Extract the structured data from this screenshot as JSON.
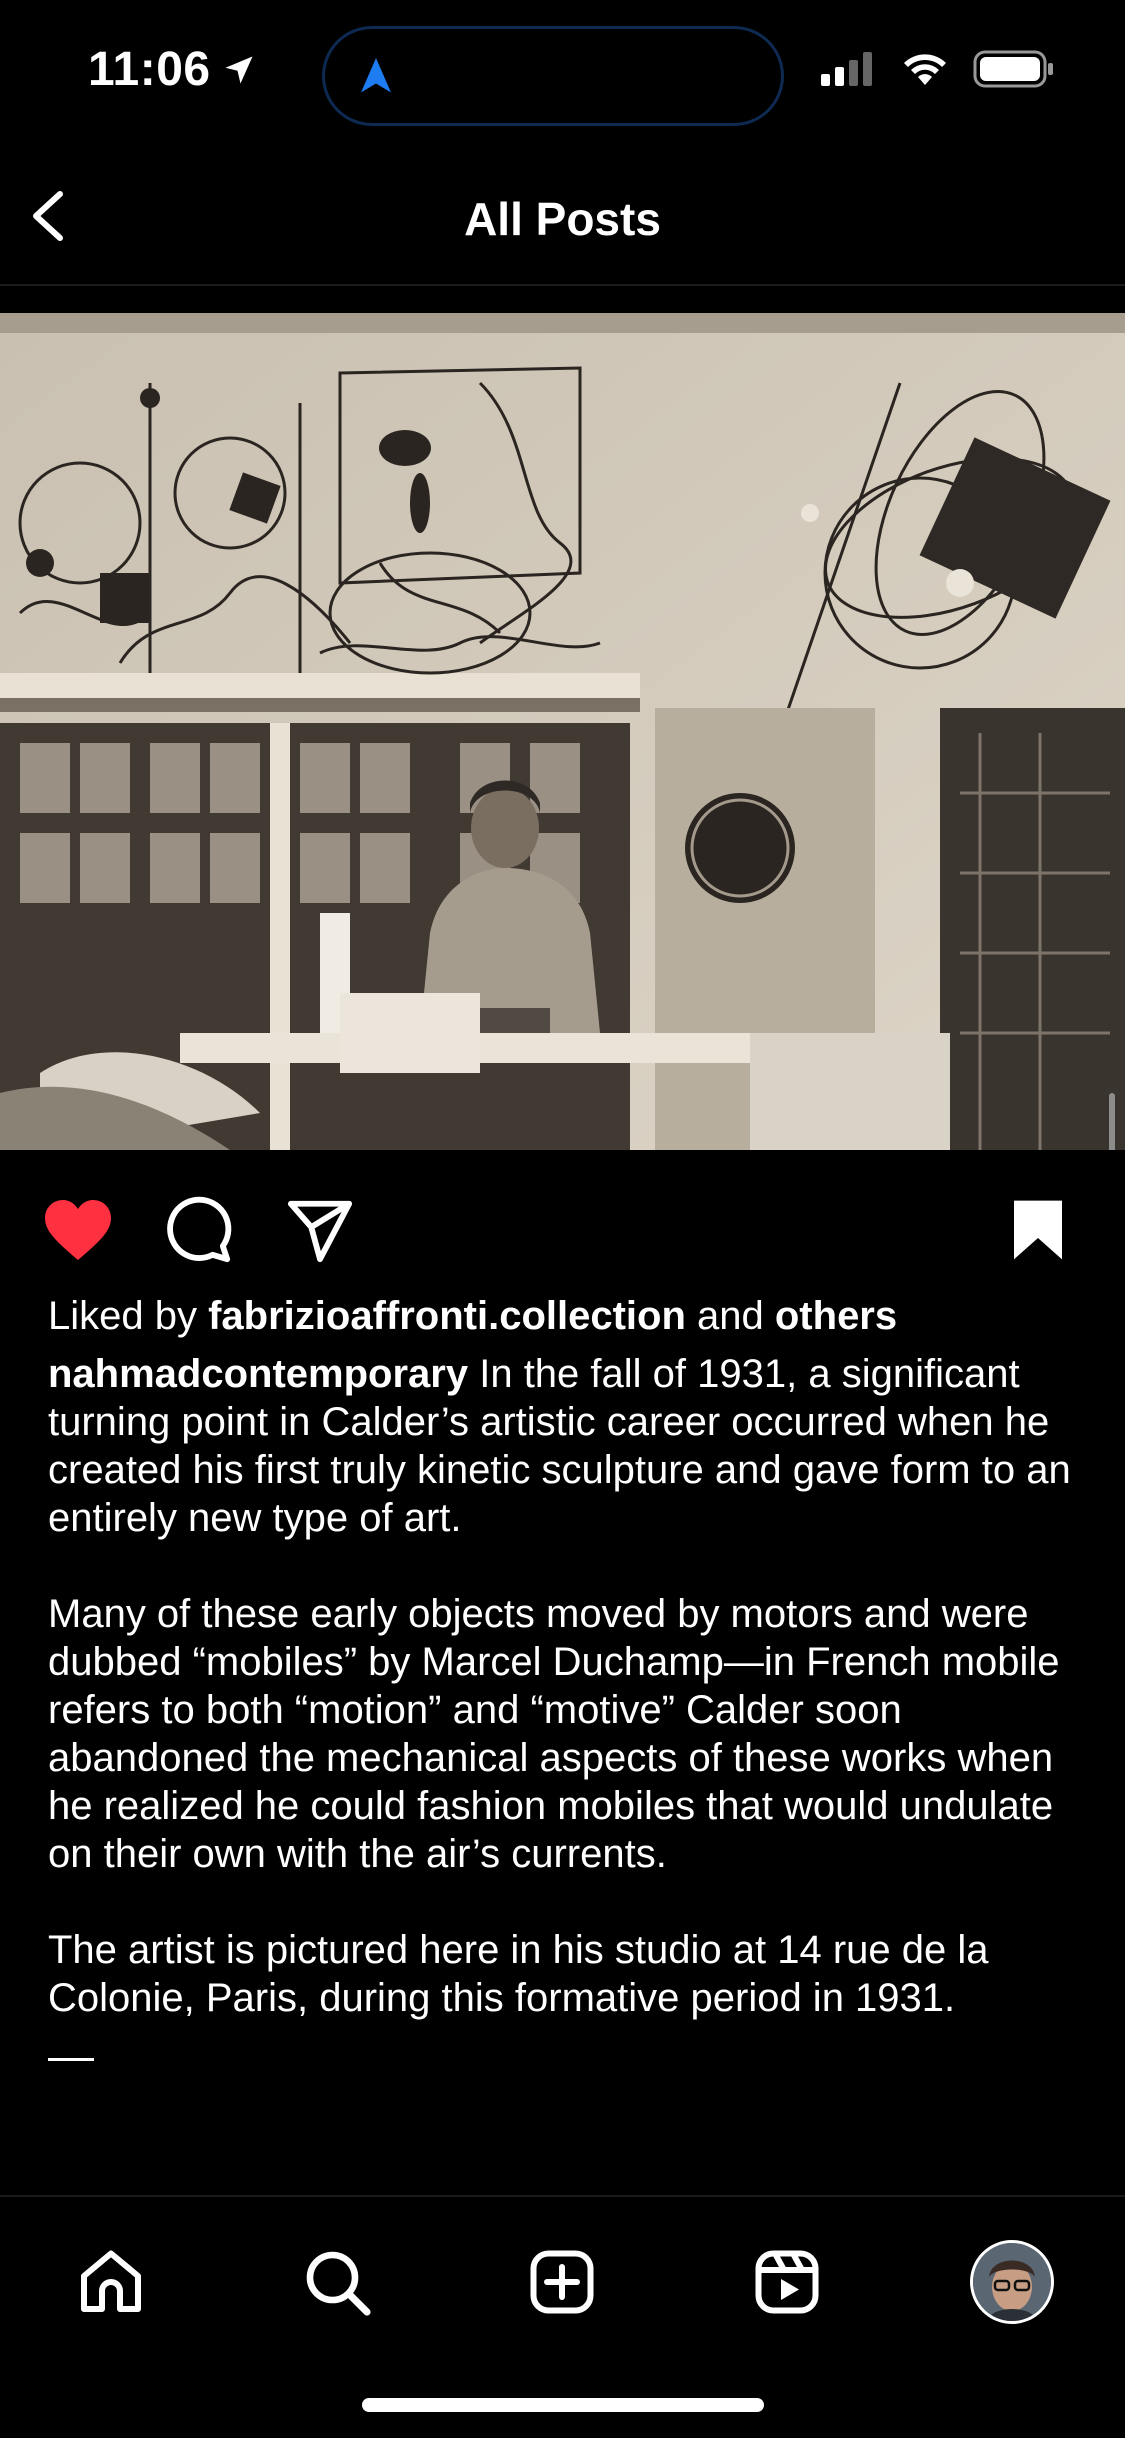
{
  "status": {
    "time": "11:06"
  },
  "header": {
    "title": "All Posts"
  },
  "post": {
    "liked_prefix": "Liked by ",
    "liked_user": "fabrizioaffronti.collection",
    "liked_mid": " and ",
    "liked_suffix": "others",
    "author": "nahmadcontemporary",
    "caption_1": " In the fall of 1931, a significant turning point in Calder’s artistic career occurred when he created his first truly kinetic sculpture and gave form to an entirely new type of art.",
    "caption_2": "Many of these early objects moved by motors and were dubbed “mobiles” by Marcel Duchamp—in French mobile refers to both “motion” and “motive” Calder soon abandoned the mechanical aspects of these works when he realized he could fashion mobiles that would undulate on their own with the air’s currents.",
    "caption_3": "The artist is pictured here in his studio at 14 rue de la Colonie, Paris, during this formative period in 1931.",
    "liked": true,
    "saved": true
  },
  "colors": {
    "like": "#ff3040",
    "background": "#000000",
    "text": "#ffffff"
  },
  "tabs": [
    "home-icon",
    "search-icon",
    "create-icon",
    "reels-icon",
    "profile-avatar"
  ]
}
